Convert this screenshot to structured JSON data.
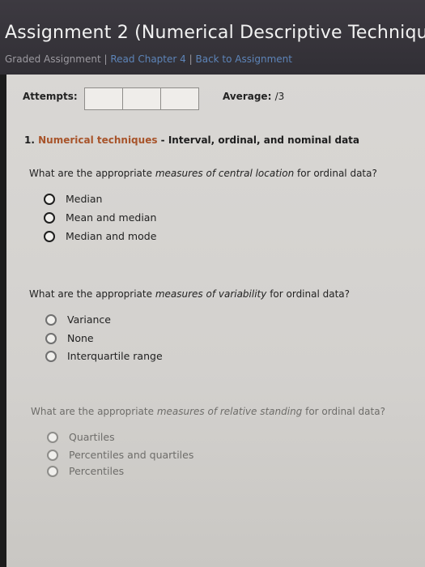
{
  "header": {
    "title": "Assignment 2 (Numerical Descriptive Techniqu",
    "graded_label": "Graded Assignment",
    "sep1": "|",
    "read_link": "Read Chapter 4",
    "sep2": "|",
    "back_link": "Back to Assignment"
  },
  "attempts": {
    "label": "Attempts:",
    "average_label": "Average:",
    "average_value": "/3"
  },
  "question": {
    "number": "1.",
    "topic": "Numerical techniques",
    "dash": " - ",
    "subtitle": "Interval, ordinal, and nominal data"
  },
  "parts": [
    {
      "prefix": "What are the appropriate ",
      "emphasis": "measures of central location",
      "suffix": " for ordinal data?",
      "options": [
        "Median",
        "Mean and median",
        "Median and mode"
      ]
    },
    {
      "prefix": "What are the appropriate ",
      "emphasis": "measures of variability",
      "suffix": " for ordinal data?",
      "options": [
        "Variance",
        "None",
        "Interquartile range"
      ]
    },
    {
      "prefix": "What are the appropriate ",
      "emphasis": "measures of relative standing",
      "suffix": " for ordinal data?",
      "options": [
        "Quartiles",
        "Percentiles and quartiles",
        "Percentiles"
      ]
    }
  ]
}
